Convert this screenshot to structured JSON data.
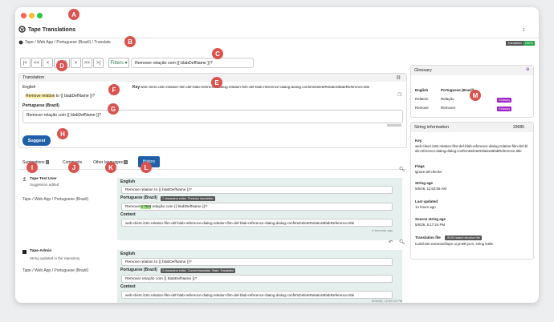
{
  "app": {
    "title": "Tape Translations",
    "user_count": "1"
  },
  "breadcrumb": {
    "items": [
      "Tape",
      "Web App",
      "Portuguese (Brazil)",
      "Translate"
    ],
    "sep": "/"
  },
  "status": {
    "translated": "Translated",
    "percent": "100%"
  },
  "nav": {
    "first": "|<",
    "prev_fast": "<<",
    "prev": "<",
    "counter": "1 / 2",
    "next": ">",
    "next_fast": ">>",
    "last": ">|",
    "filters": "Filters",
    "search_value": "Remover relação com {{ blabDefName }}?"
  },
  "translation": {
    "header": "Translation",
    "source_label": "English",
    "key_label": "Key",
    "key_value": "web-client.i18n.relation-film-def-blab-reference-dialog.relation-film-def-blab-reference-dialog.dialog.confirmDeleteRelationBlabReference.title",
    "source_text": "Remove relation to {{ blabDefName }}?",
    "target_label": "Portuguese (Brazil)",
    "target_text": "Remover relação com {{ blabDefName }}?",
    "suggest_button": "Suggest"
  },
  "tabs": {
    "suggestions": "Suggestions",
    "suggestions_count": "1",
    "comments": "Comments",
    "other_languages": "Other languages",
    "other_count": "0",
    "history": "History"
  },
  "history": [
    {
      "user": "Tape Test User",
      "action": "Suggestion added",
      "path": "Tape / Web App / Portuguese (Brazil)",
      "english_label": "English",
      "english_text": "Remove relation to {{ blabDefName }}?",
      "pt_label": "Portuguese (Brazil)",
      "pt_tags": [
        "7 characters edited",
        "Previous translation"
      ],
      "pt_text_before": "Remover",
      "pt_text_highlight": "o Test",
      "pt_text_after": " relação com {{ blabDefName }}?",
      "context_label": "Context",
      "context_text": "web-client.i18n.relation-film-def-blab-reference-dialog.relation-film-def-blab-reference-dialog.dialog.confirmDeleteRelationBlabReference.title",
      "time": "4 seconds ago"
    },
    {
      "user": "Tape-Admin",
      "action": "String updated in the repository",
      "path": "Tape / Web App / Portuguese (Brazil)",
      "english_label": "English",
      "english_text": "Remove relation to {{ blabDefName }}?",
      "pt_label": "Portuguese (Brazil)",
      "pt_tags": [
        "0 characters edited",
        "Current translation",
        "State: Translated"
      ],
      "pt_text": "Remover relação com {{ blabDefName }}?",
      "context_label": "Context",
      "context_text": "web-client.i18n.relation-film-def-blab-reference-dialog.relation-film-def-blab-reference-dialog.dialog.confirmDeleteRelationBlabReference.title",
      "time": "5/26/26, 12:59:12 PM"
    }
  ],
  "glossary": {
    "title": "Glossary",
    "col_en": "English",
    "col_pt": "Portuguese (Brazil)",
    "rows": [
      {
        "en": "Relation",
        "pt": "Relação",
        "tag": "Glossary"
      },
      {
        "en": "Remove",
        "pt": "Remover",
        "tag": "Glossary"
      }
    ]
  },
  "string_info": {
    "title": "String information",
    "id": "29685",
    "key_label": "Key",
    "key_value": "web-client.i18n.relation-film-def-blab-reference-dialog.relation-film-def-blab-reference-dialog.dialog.confirmDeleteRelationBlabReference.title",
    "flags_label": "Flags",
    "flags_value": "ignore-all-checks",
    "string_age_label": "String age",
    "string_age_value": "5/5/26, 11:52:06 AM",
    "last_updated_label": "Last updated",
    "last_updated_value": "14 hours ago",
    "source_age_label": "Source string age",
    "source_age_value": "5/6/26, 5:17:24 PM",
    "file_label": "Translation file",
    "file_tag": "JSON nested structure file",
    "file_value": "tools/i18n-extracted/tape-ui.pt-BR.json, string 6405"
  },
  "markers": [
    "A",
    "B",
    "C",
    "D",
    "E",
    "F",
    "G",
    "H",
    "I",
    "J",
    "K",
    "L",
    "M"
  ]
}
